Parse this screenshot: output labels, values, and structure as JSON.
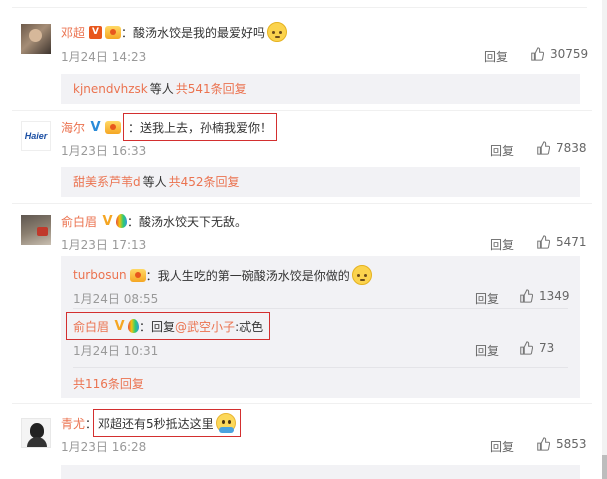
{
  "comments": [
    {
      "username": "邓超",
      "text": "酸汤水饺是我的最爱好吗",
      "date": "1月24日 14:23",
      "reply_label": "回复",
      "likes": "30759",
      "summary": {
        "name": "kjnendvhzsk",
        "mid": "等人",
        "count": "共541条回复"
      }
    },
    {
      "username": "海尔",
      "avatar_text": "Haier",
      "text": "送我上去，孙楠我爱你！",
      "date": "1月23日 16:33",
      "reply_label": "回复",
      "likes": "7838",
      "summary": {
        "name": "甜美系芦苇d",
        "mid": "等人",
        "count": "共452条回复"
      }
    },
    {
      "username": "俞白眉",
      "text": "酸汤水饺天下无敌。",
      "date": "1月23日 17:13",
      "reply_label": "回复",
      "likes": "5471",
      "replies": [
        {
          "username": "turbosun",
          "text": "我人生吃的第一碗酸汤水饺是你做的",
          "date": "1月24日 08:55",
          "reply_label": "回复",
          "likes": "1349"
        },
        {
          "username": "俞白眉",
          "prefix": "回复",
          "mention": "@武空小子",
          "text": ":忒色",
          "date": "1月24日 10:31",
          "reply_label": "回复",
          "likes": "73"
        }
      ],
      "more": "共116条回复"
    },
    {
      "username": "青尤",
      "text": "邓超还有5秒抵达这里",
      "date": "1月23日 16:28",
      "reply_label": "回复",
      "likes": "5853"
    }
  ],
  "colors": {
    "username": "#eb7350",
    "muted": "#999999",
    "reply_bg": "#f2f2f5",
    "highlight_box": "#d32f2f"
  },
  "icons": {
    "like": "thumbs-up-icon",
    "verified": "verified-v-icon",
    "member": "member-crown-icon",
    "emoji_cat": "cat-face-emoji",
    "emoji_smile": "smiling-face-emoji"
  }
}
